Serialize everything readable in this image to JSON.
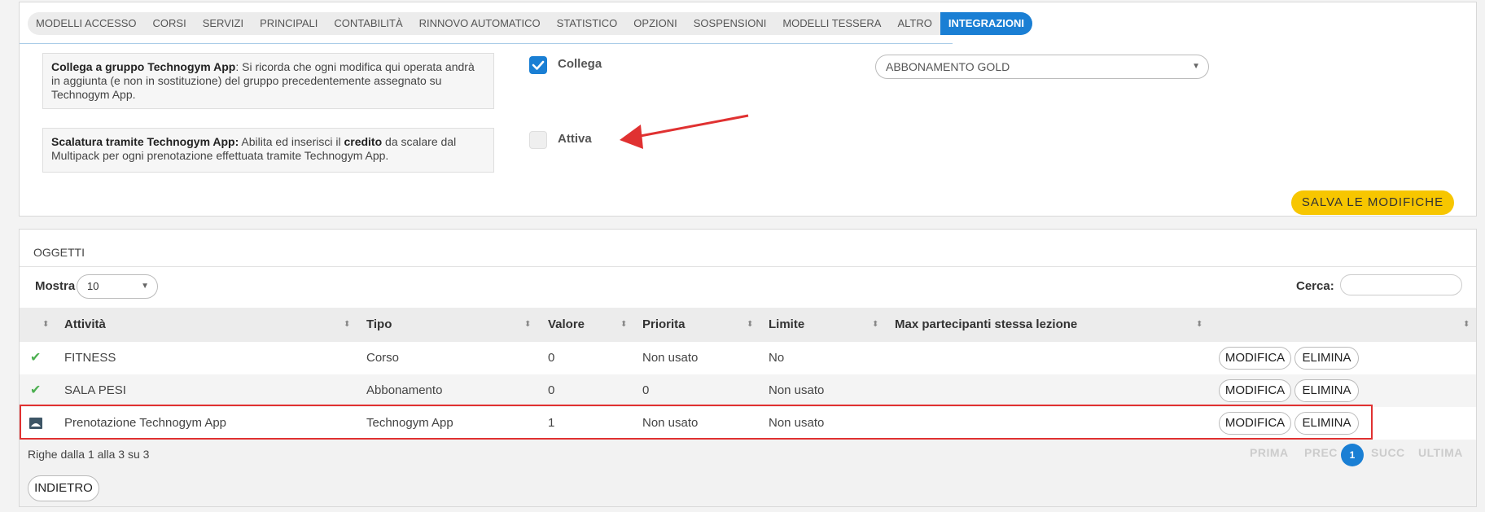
{
  "tabs": [
    {
      "label": "MODELLI ACCESSO"
    },
    {
      "label": "CORSI"
    },
    {
      "label": "SERVIZI"
    },
    {
      "label": "PRINCIPALI"
    },
    {
      "label": "CONTABILITÀ"
    },
    {
      "label": "RINNOVO AUTOMATICO"
    },
    {
      "label": "STATISTICO"
    },
    {
      "label": "OPZIONI"
    },
    {
      "label": "SOSPENSIONI"
    },
    {
      "label": "MODELLI TESSERA"
    },
    {
      "label": "ALTRO"
    },
    {
      "label": "INTEGRAZIONI",
      "active": true
    }
  ],
  "settings": {
    "group": {
      "title": "Collega a gruppo Technogym App",
      "text": ": Si ricorda che ogni modifica qui operata andrà in aggiunta (e non in sostituzione) del gruppo precedentemente assegnato su Technogym App.",
      "checkbox_label": "Collega",
      "checked": true,
      "select_value": "ABBONAMENTO GOLD"
    },
    "scaling": {
      "title": "Scalatura tramite Technogym App:",
      "text_1": " Abilita ed inserisci il ",
      "bold_word": "credito",
      "text_2": " da scalare dal Multipack per ogni prenotazione effettuata tramite Technogym App.",
      "checkbox_label": "Attiva",
      "checked": false
    },
    "save_label": "SALVA LE MODIFICHE"
  },
  "objects": {
    "title": "OGGETTI",
    "show_label": "Mostra",
    "page_length": "10",
    "search_label": "Cerca:",
    "columns": [
      "Attività",
      "Tipo",
      "Valore",
      "Priorita",
      "Limite",
      "Max partecipanti stessa lezione"
    ],
    "rows": [
      {
        "icon": "check-icon",
        "activity": "FITNESS",
        "type": "Corso",
        "value": "0",
        "priority": "Non usato",
        "limit": "No",
        "max": ""
      },
      {
        "icon": "check-icon",
        "activity": "SALA PESI",
        "type": "Abbonamento",
        "value": "0",
        "priority": "0",
        "limit": "Non usato",
        "max": ""
      },
      {
        "icon": "app-icon",
        "activity": "Prenotazione Technogym App",
        "type": "Technogym App",
        "value": "1",
        "priority": "Non usato",
        "limit": "Non usato",
        "max": ""
      }
    ],
    "edit_label": "MODIFICA",
    "delete_label": "ELIMINA",
    "info": "Righe dalla 1 alla 3 su 3",
    "pager": {
      "first": "PRIMA",
      "prev": "PREC",
      "current": "1",
      "next": "SUCC",
      "last": "ULTIMA"
    },
    "back_label": "INDIETRO"
  },
  "colors": {
    "accent": "#1a7fd4",
    "save": "#f7c600",
    "highlight": "#e03131",
    "check": "#4caf50"
  }
}
